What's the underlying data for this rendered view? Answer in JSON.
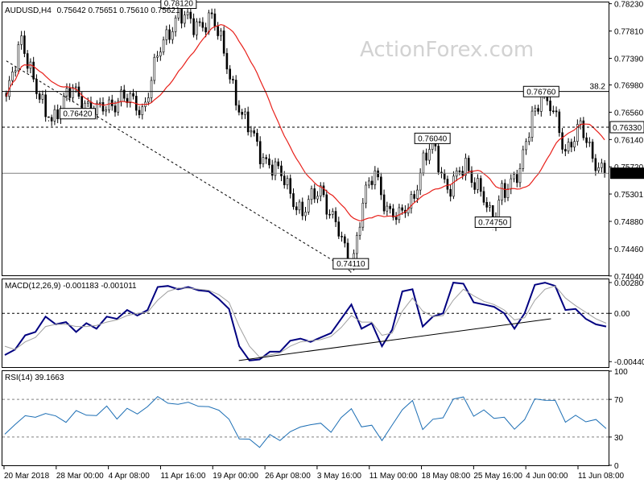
{
  "header": {
    "symbol": "AUDUSD,H4",
    "ohlc": "0.75642 0.75651 0.75610 0.75621"
  },
  "watermark": "ActionForex.com",
  "chart_data": [
    {
      "type": "candlestick",
      "symbol": "AUDUSD",
      "timeframe": "H4",
      "ylim": [
        0.7405,
        0.7825
      ],
      "y_ticks": [
        "0.78230",
        "0.77810",
        "0.77390",
        "0.76980",
        "0.76560",
        "0.76140",
        "0.75720",
        "0.75301",
        "0.74880",
        "0.74460",
        "0.74040"
      ],
      "last_price": "0.75621",
      "level_labels": [
        "38.2",
        "0.76330"
      ],
      "callouts": [
        "0.78120",
        "0.76420",
        "0.76760",
        "0.76040",
        "0.74750",
        "0.74110"
      ],
      "pivots": [
        {
          "label": "0.78120",
          "bar": 57,
          "value": 0.7812
        },
        {
          "label": "0.76420",
          "bar": 14,
          "value": 0.7642
        },
        {
          "label": "0.76760",
          "bar": 177,
          "value": 0.7676
        },
        {
          "label": "0.76040",
          "bar": 141,
          "value": 0.7604
        },
        {
          "label": "0.74750",
          "bar": 161,
          "value": 0.7475
        },
        {
          "label": "0.74110",
          "bar": 114,
          "value": 0.7411
        }
      ],
      "anchors": [
        [
          0,
          0.767
        ],
        [
          5,
          0.7775
        ],
        [
          10,
          0.7685
        ],
        [
          14,
          0.7642
        ],
        [
          22,
          0.769
        ],
        [
          30,
          0.7655
        ],
        [
          38,
          0.768
        ],
        [
          45,
          0.766
        ],
        [
          50,
          0.774
        ],
        [
          57,
          0.7812
        ],
        [
          62,
          0.7785
        ],
        [
          68,
          0.7805
        ],
        [
          72,
          0.7745
        ],
        [
          78,
          0.765
        ],
        [
          84,
          0.7595
        ],
        [
          92,
          0.755
        ],
        [
          98,
          0.75
        ],
        [
          104,
          0.754
        ],
        [
          110,
          0.747
        ],
        [
          114,
          0.7411
        ],
        [
          118,
          0.752
        ],
        [
          122,
          0.756
        ],
        [
          126,
          0.751
        ],
        [
          130,
          0.749
        ],
        [
          134,
          0.752
        ],
        [
          138,
          0.758
        ],
        [
          141,
          0.7604
        ],
        [
          146,
          0.754
        ],
        [
          152,
          0.757
        ],
        [
          157,
          0.754
        ],
        [
          161,
          0.7475
        ],
        [
          164,
          0.754
        ],
        [
          170,
          0.756
        ],
        [
          174,
          0.7655
        ],
        [
          177,
          0.7676
        ],
        [
          181,
          0.7655
        ],
        [
          185,
          0.76
        ],
        [
          190,
          0.763
        ],
        [
          194,
          0.759
        ],
        [
          198,
          0.7562
        ]
      ],
      "bar_count": 199,
      "moving_average_period": 20,
      "horizontal_levels": [
        {
          "label": "38.2",
          "value": 0.7688,
          "style": "solid"
        },
        {
          "label": "0.76330",
          "value": 0.7633,
          "style": "dashed"
        },
        {
          "label": "current",
          "value": 0.75621,
          "style": "solid"
        }
      ],
      "trendline": {
        "from": [
          0,
          0.7735
        ],
        "to": [
          114,
          0.7411
        ],
        "style": "dashed"
      },
      "colors": {
        "candle": "#000000",
        "ma": "#e8201a",
        "levels": "#000000"
      }
    },
    {
      "type": "line",
      "title": "MACD(12,26,9) -0.001183 -0.001011",
      "ylim": [
        -0.0049,
        0.0031
      ],
      "y_ticks": [
        "0.002809",
        "0.00",
        "-0.004403"
      ],
      "zero_line": true,
      "series": [
        {
          "values": [
            -0.0038,
            -0.0033,
            -0.002,
            -0.0017,
            -0.0003,
            -0.001,
            -0.0008,
            -0.0017,
            -0.0009,
            -0.0014,
            -0.0003,
            -0.0005,
            0.0003,
            -0.0002,
            0.0003,
            0.0024,
            0.0025,
            0.0022,
            0.0024,
            0.0021,
            0.002,
            0.0013,
            0.0004,
            -0.003,
            -0.0043,
            -0.0042,
            -0.0035,
            -0.0035,
            -0.0025,
            -0.0023,
            -0.0026,
            -0.0022,
            -0.0018,
            -0.0005,
            0.0008,
            -0.0014,
            -0.0009,
            -0.003,
            -0.0015,
            0.002,
            0.0022,
            -0.0012,
            -0.0003,
            0.0,
            0.0028,
            0.0027,
            0.001,
            0.0008,
            0.0006,
            0.0,
            -0.0014,
            0.0,
            0.0026,
            0.0028,
            0.0025,
            0.0003,
            0.0004,
            -0.0005,
            -0.001,
            -0.0012
          ],
          "color": "#000080"
        },
        {
          "values": [
            -0.003,
            -0.0033,
            -0.0026,
            -0.0022,
            -0.0012,
            -0.001,
            -0.001,
            -0.0012,
            -0.0012,
            -0.0011,
            -0.0008,
            -0.0006,
            -0.0002,
            0.0,
            0.0001,
            0.0012,
            0.002,
            0.0023,
            0.0023,
            0.0022,
            0.0021,
            0.0017,
            0.001,
            -0.0012,
            -0.003,
            -0.004,
            -0.0038,
            -0.0036,
            -0.003,
            -0.0026,
            -0.0025,
            -0.0024,
            -0.0021,
            -0.0013,
            -0.0002,
            -0.0008,
            -0.0008,
            -0.002,
            -0.0018,
            0.0002,
            0.0014,
            0.0002,
            -0.0003,
            -0.0002,
            0.0012,
            0.0022,
            0.0016,
            0.0011,
            0.0008,
            0.0003,
            -0.0006,
            -0.0004,
            0.0012,
            0.0022,
            0.0025,
            0.0014,
            0.0007,
            0.0001,
            -0.0005,
            -0.0009
          ],
          "color": "#a0a0a0"
        }
      ],
      "trendline": {
        "from": [
          0.39,
          -0.0043
        ],
        "to": [
          0.905,
          -0.0005
        ]
      }
    },
    {
      "type": "line",
      "title": "RSI(14) 39.1663",
      "ylim": [
        0,
        100
      ],
      "y_ticks": [
        "100",
        "70",
        "30",
        "0"
      ],
      "levels": [
        70,
        30
      ],
      "series": [
        {
          "values": [
            33,
            42,
            55,
            48,
            58,
            50,
            47,
            58,
            52,
            55,
            60,
            52,
            58,
            56,
            62,
            72,
            68,
            62,
            70,
            60,
            64,
            58,
            48,
            30,
            25,
            22,
            30,
            28,
            35,
            40,
            45,
            42,
            38,
            48,
            62,
            40,
            42,
            28,
            40,
            62,
            66,
            40,
            48,
            50,
            72,
            70,
            55,
            56,
            52,
            50,
            38,
            50,
            68,
            72,
            66,
            48,
            52,
            46,
            50,
            39
          ],
          "color": "#1c6eb4"
        }
      ]
    }
  ],
  "x_axis": {
    "labels": [
      "20 Mar 2018",
      "28 Mar 00:00",
      "4 Apr 08:00",
      "11 Apr 16:00",
      "19 Apr 00:00",
      "26 Apr 08:00",
      "3 May 16:00",
      "11 May 00:00",
      "18 May 08:00",
      "25 May 16:00",
      "4 Jun 00:00",
      "11 Jun 08:00"
    ]
  }
}
